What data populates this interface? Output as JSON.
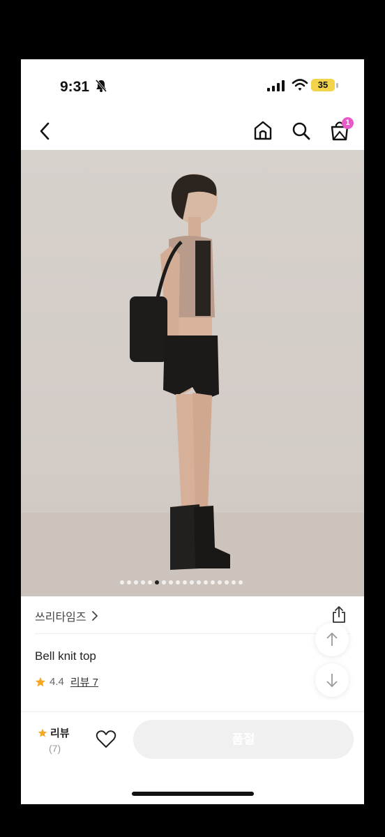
{
  "status_bar": {
    "time": "9:31",
    "battery": "35",
    "icons": [
      "bell-slash-icon",
      "signal-icon",
      "wifi-icon",
      "battery-icon"
    ]
  },
  "nav": {
    "icons": [
      "back-icon",
      "home-icon",
      "search-icon",
      "shopping-bag-icon"
    ],
    "cart_count": "1",
    "badge_color": "#e85ac9"
  },
  "gallery": {
    "image_count": 18,
    "active_index": 5
  },
  "product": {
    "brand": "쓰리타임즈",
    "name": "Bell knit top",
    "rating": "4.4",
    "review_link": "리뷰 7"
  },
  "bottom_bar": {
    "review_label": "리뷰",
    "review_count": "(7)",
    "soldout_label": "품절"
  },
  "colors": {
    "star": "#f5a623",
    "soldout_bg": "#f0f0f0"
  }
}
